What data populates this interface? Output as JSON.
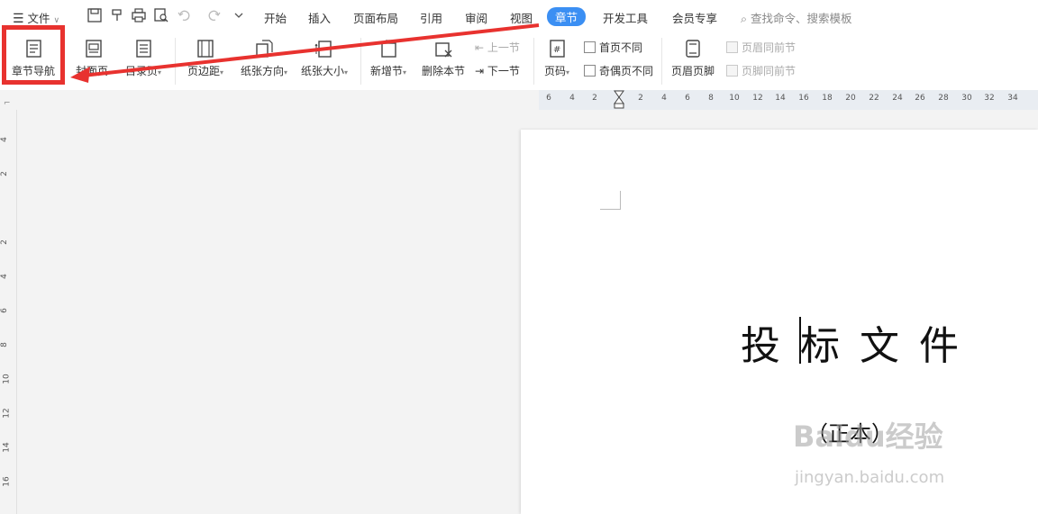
{
  "menubar": {
    "file_label": "文件",
    "tabs": [
      {
        "label": "开始"
      },
      {
        "label": "插入"
      },
      {
        "label": "页面布局"
      },
      {
        "label": "引用"
      },
      {
        "label": "审阅"
      },
      {
        "label": "视图"
      },
      {
        "label": "章节",
        "active": true
      },
      {
        "label": "开发工具"
      },
      {
        "label": "会员专享"
      }
    ],
    "search_placeholder": "查找命令、搜索模板"
  },
  "ribbon": {
    "chapter_nav": "章节导航",
    "cover_page": "封面页",
    "toc_page": "目录页",
    "margins": "页边距",
    "orientation": "纸张方向",
    "paper_size": "纸张大小",
    "new_section": "新增节",
    "delete_section": "删除本节",
    "prev_section": "上一节",
    "next_section": "下一节",
    "page_number": "页码",
    "first_page_diff": "首页不同",
    "odd_even_diff": "奇偶页不同",
    "header_footer": "页眉页脚",
    "header_same_prev": "页眉同前节",
    "footer_same_prev": "页脚同前节"
  },
  "ruler": {
    "h_ticks": [
      "6",
      "4",
      "2",
      "2",
      "4",
      "6",
      "8",
      "10",
      "12",
      "14",
      "16",
      "18",
      "20",
      "22",
      "24",
      "26",
      "28",
      "30",
      "32",
      "34"
    ],
    "v_ticks": [
      "4",
      "2",
      "2",
      "4",
      "6",
      "8",
      "10",
      "12",
      "14",
      "16"
    ]
  },
  "document": {
    "title": "投标文件",
    "subtitle": "（正本）"
  },
  "watermark": {
    "brand": "Baidu经验",
    "url": "jingyan.baidu.com"
  },
  "colors": {
    "accent": "#3b8ff3",
    "highlight": "#e8322f"
  }
}
